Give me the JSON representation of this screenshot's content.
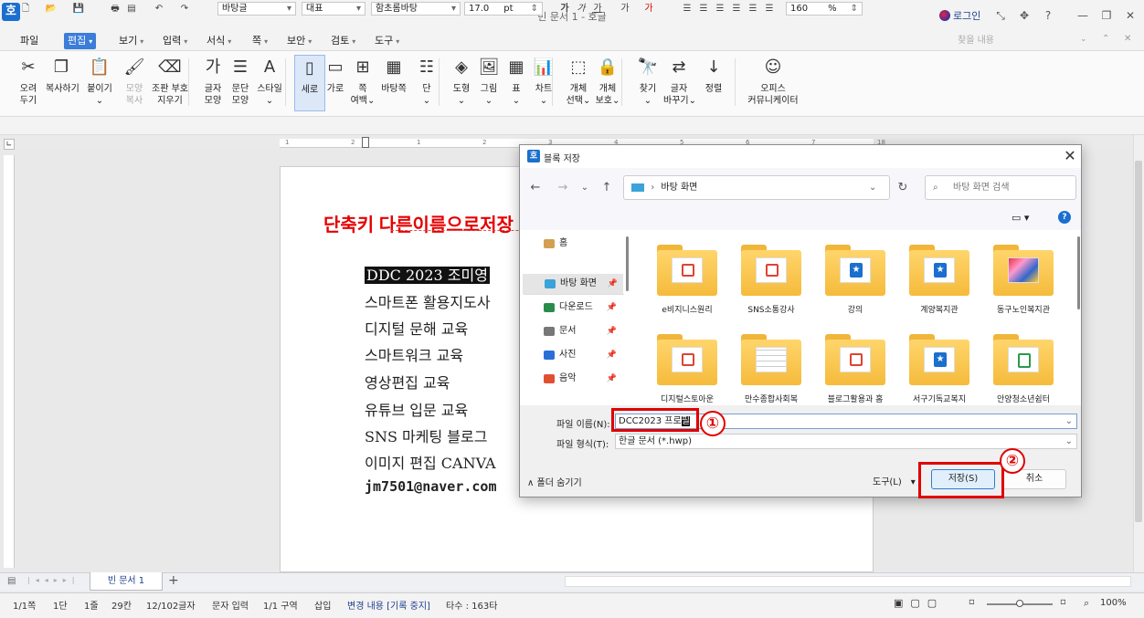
{
  "window": {
    "title": "빈 문서 1 - 호글",
    "logo": "호",
    "login": "로그인",
    "controls": [
      "⤡",
      "✥",
      "?",
      "—",
      "❐",
      "✕"
    ]
  },
  "menubar": {
    "items": [
      {
        "label": "파일",
        "caret": false
      },
      {
        "label": "편집",
        "caret": true,
        "active": true
      },
      {
        "label": "보기",
        "caret": true
      },
      {
        "label": "입력",
        "caret": true
      },
      {
        "label": "서식",
        "caret": true
      },
      {
        "label": "쪽",
        "caret": true
      },
      {
        "label": "보안",
        "caret": true
      },
      {
        "label": "검토",
        "caret": true
      },
      {
        "label": "도구",
        "caret": true
      }
    ],
    "search_placeholder": "찾을 내용"
  },
  "ribbon": {
    "items": [
      {
        "line1": "오려",
        "line2": "두기"
      },
      {
        "line1": "복사하기",
        "line2": ""
      },
      {
        "line1": "붙이기",
        "line2": "⌄"
      },
      {
        "line1": "모양",
        "line2": "복사"
      },
      {
        "line1": "조판 부호",
        "line2": "지우기"
      },
      {
        "line1": "글자",
        "line2": "모양"
      },
      {
        "line1": "문단",
        "line2": "모양"
      },
      {
        "line1": "스타일",
        "line2": "⌄"
      },
      {
        "line1": "세로",
        "line2": ""
      },
      {
        "line1": "가로",
        "line2": ""
      },
      {
        "line1": "쪽",
        "line2": "여백⌄"
      },
      {
        "line1": "바탕쪽",
        "line2": ""
      },
      {
        "line1": "단",
        "line2": "⌄"
      },
      {
        "line1": "도형",
        "line2": "⌄"
      },
      {
        "line1": "그림",
        "line2": "⌄"
      },
      {
        "line1": "표",
        "line2": "⌄"
      },
      {
        "line1": "차트",
        "line2": "⌄"
      },
      {
        "line1": "개체",
        "line2": "선택⌄"
      },
      {
        "line1": "개체",
        "line2": "보호⌄"
      },
      {
        "line1": "찾기",
        "line2": "⌄"
      },
      {
        "line1": "글자",
        "line2": "바꾸기⌄"
      },
      {
        "line1": "정렬",
        "line2": ""
      },
      {
        "line1": "오피스",
        "line2": "커뮤니케이터"
      }
    ]
  },
  "format": {
    "style": "바탕글",
    "lang": "대표",
    "font": "함초롬바탕",
    "size": "17.0",
    "unit": "pt",
    "zoom": "160",
    "zoom_unit": "%"
  },
  "ruler": {
    "ticks": [
      "1",
      "2",
      "1",
      "2",
      "3",
      "4",
      "5",
      "6",
      "7",
      "18"
    ]
  },
  "doc": {
    "heading": "단축키 다른이름으로저장 Alt + V",
    "lines": [
      "DDC 2023 조미영",
      "스마트폰 활용지도사",
      "디지털 문해 교육",
      "스마트워크 교육",
      "영상편집 교육",
      "유튜브 입문 교육",
      "SNS 마케팅 블로그",
      "이미지 편집 CANVA",
      "jm7501@naver.com"
    ]
  },
  "dialog": {
    "title": "블록 저장",
    "close": "✕",
    "path": "바탕 화면",
    "search_placeholder": "바탕 화면 검색",
    "sidebar": [
      {
        "label": "홈",
        "icon": "home-icon",
        "pinned": false
      },
      {
        "label": "바탕 화면",
        "icon": "desktop-icon",
        "pinned": true,
        "selected": true
      },
      {
        "label": "다운로드",
        "icon": "download-icon",
        "pinned": true
      },
      {
        "label": "문서",
        "icon": "document-icon",
        "pinned": true
      },
      {
        "label": "사진",
        "icon": "photo-icon",
        "pinned": true
      },
      {
        "label": "음악",
        "icon": "music-icon",
        "pinned": true
      }
    ],
    "files": [
      {
        "name": "e비지니스원리",
        "kind": "pdf"
      },
      {
        "name": "SNS소통강사",
        "kind": "pdf"
      },
      {
        "name": "강의",
        "kind": "hwp"
      },
      {
        "name": "계양복지관",
        "kind": "hwp"
      },
      {
        "name": "동구노인복지관",
        "kind": "image"
      },
      {
        "name": "디지털스토아운",
        "kind": "pdf"
      },
      {
        "name": "만수종합사회복",
        "kind": "table"
      },
      {
        "name": "블로그활용과 홈",
        "kind": "pdf"
      },
      {
        "name": "서구기독교복지",
        "kind": "hwp"
      },
      {
        "name": "안양청소년쉼터",
        "kind": "chart"
      }
    ],
    "filename_label": "파일 이름(N):",
    "filename_value": "DCC2023 프로",
    "filename_cursor": "필",
    "filetype_label": "파일 형식(T):",
    "filetype_value": "한글 문서 (*.hwp)",
    "hide_folders": "폴더 숨기기",
    "tools": "도구(L)",
    "save": "저장(S)",
    "cancel": "취소"
  },
  "annotations": {
    "one": "①",
    "two": "②"
  },
  "tabs": {
    "doc_tab": "빈 문서 1",
    "add": "+"
  },
  "status": {
    "page": "1/1쪽",
    "col": "1단",
    "line": "1줄",
    "char": "29칸",
    "count": "12/102글자",
    "mode": "문자 입력",
    "section": "1/1 구역",
    "insert": "삽입",
    "track": "변경 내용 [기록 중지]",
    "typing": "타수 : 163타",
    "zoom": "100%"
  },
  "colors": {
    "accent": "#3b7dd8",
    "annotation": "#e00000",
    "heading": "#e60000",
    "folder": "#f5bb3c"
  }
}
